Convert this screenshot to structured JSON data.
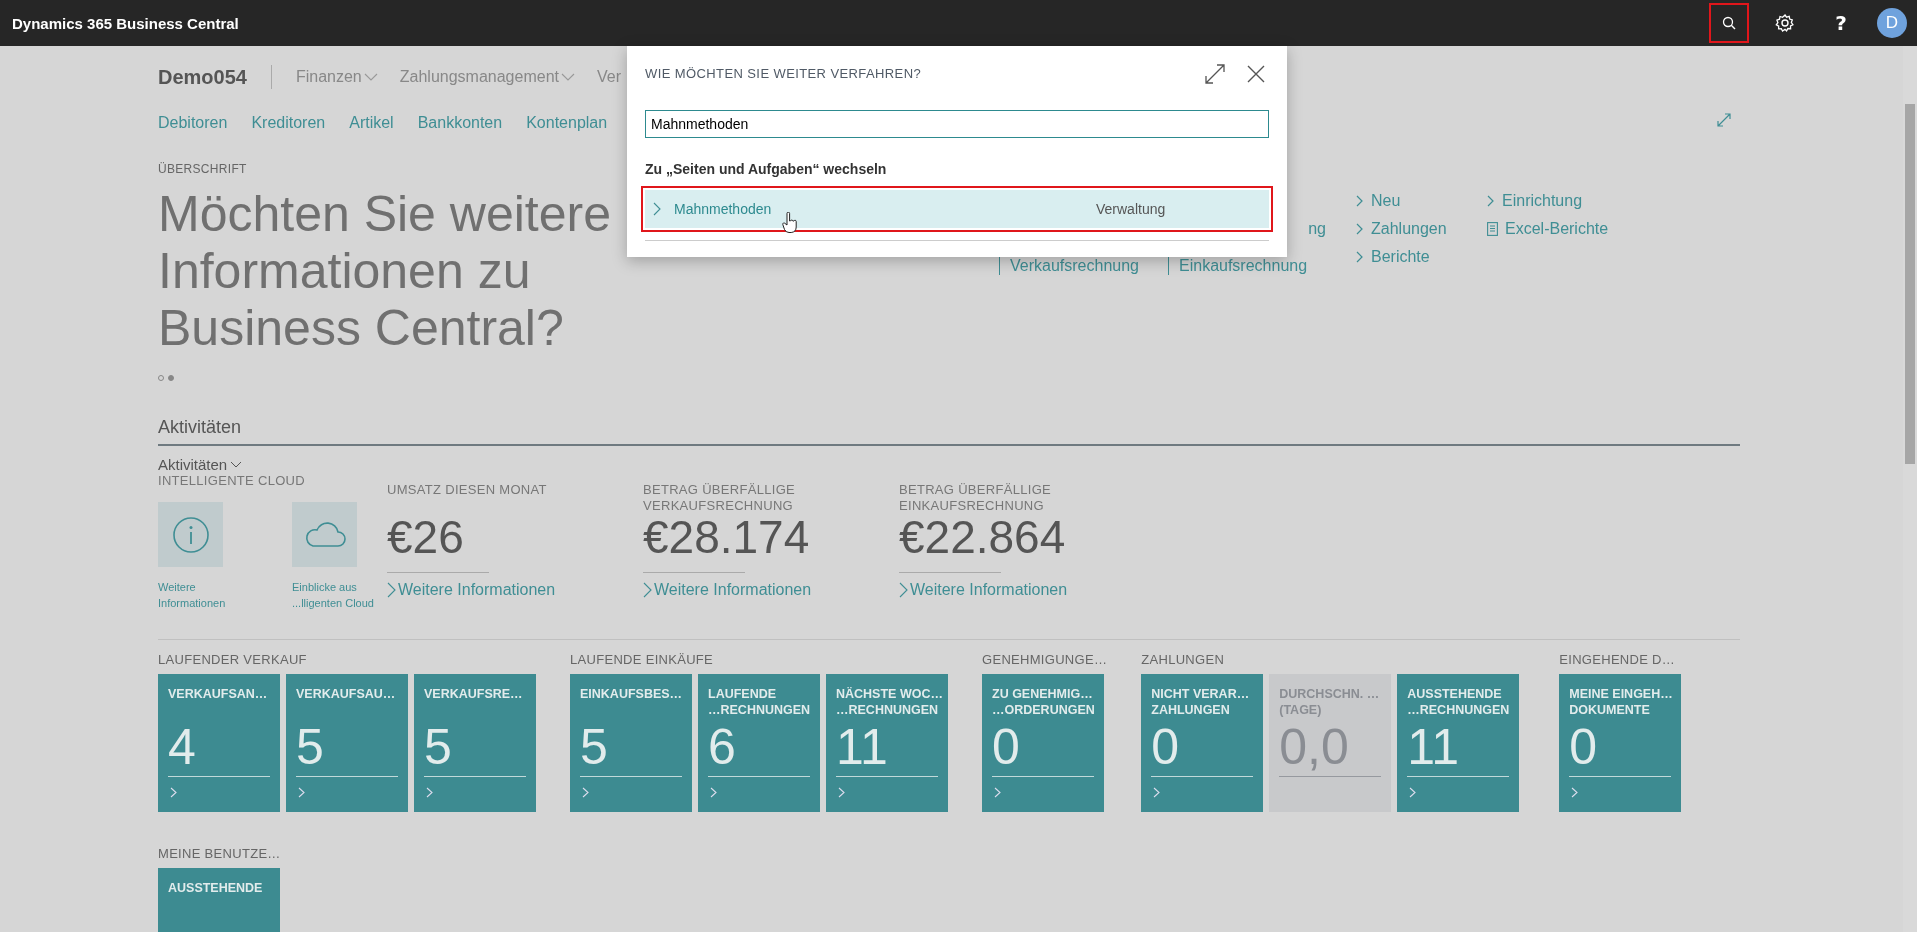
{
  "app_bar": {
    "title": "Dynamics 365 Business Central",
    "avatar": "D",
    "help": "?",
    "search_highlighted": true
  },
  "role_center": {
    "company": "Demo054",
    "menus": [
      {
        "label": "Finanzen",
        "has_menu": true
      },
      {
        "label": "Zahlungsmanagement",
        "has_menu": true
      },
      {
        "label": "Ver",
        "has_menu": false
      }
    ],
    "nav_links": [
      "Debitoren",
      "Kreditoren",
      "Artikel",
      "Bankkonten",
      "Kontenplan"
    ]
  },
  "headline": {
    "caption": "ÜBERSCHRIFT",
    "text": "Möchten Sie weitere Informationen zu Business Central?",
    "dots": [
      {
        "selected": false
      },
      {
        "selected": true
      }
    ]
  },
  "actions": [
    {
      "items": [
        {
          "label": "Verkaufsrechnung",
          "kind": "bar"
        }
      ]
    },
    {
      "items": [
        {
          "label": "ng",
          "kind": "fragment"
        },
        {
          "label": "Einkaufsrechnung",
          "kind": "bar"
        }
      ]
    },
    {
      "items": [
        {
          "label": "Neu",
          "kind": "chevron"
        },
        {
          "label": "Zahlungen",
          "kind": "chevron"
        },
        {
          "label": "Berichte",
          "kind": "chevron"
        }
      ]
    },
    {
      "items": [
        {
          "label": "Einrichtung",
          "kind": "chevron"
        },
        {
          "label": "Excel-Berichte",
          "kind": "report"
        }
      ]
    }
  ],
  "activities": {
    "title": "Aktivitäten",
    "group": "Aktivitäten",
    "cloud": {
      "label": "INTELLIGENTE CLOUD",
      "tiles": [
        {
          "caption": "Weitere Informationen",
          "kind": "info"
        },
        {
          "caption": "Einblicke aus ...lligenten Cloud",
          "kind": "cloud"
        }
      ]
    },
    "kpis": [
      {
        "label": "UMSATZ DIESEN MONAT",
        "value": "€26",
        "link": "Weitere Informationen"
      },
      {
        "label": "BETRAG ÜBERFÄLLIGE VERKAUFSRECHNUNG",
        "value": "€28.174",
        "link": "Weitere Informationen"
      },
      {
        "label": "BETRAG ÜBERFÄLLIGE EINKAUFSRECHNUNG",
        "value": "€22.864",
        "link": "Weitere Informationen"
      }
    ]
  },
  "tile_groups": [
    {
      "title": "LAUFENDER VERKAUF",
      "tiles": [
        {
          "lines": [
            "VERKAUFSAN…"
          ],
          "value": "4",
          "kind": "teal"
        },
        {
          "lines": [
            "VERKAUFSAU…"
          ],
          "value": "5",
          "kind": "teal"
        },
        {
          "lines": [
            "VERKAUFSRE…"
          ],
          "value": "5",
          "kind": "teal"
        }
      ]
    },
    {
      "title": "LAUFENDE EINKÄUFE",
      "tiles": [
        {
          "lines": [
            "EINKAUFSBES…"
          ],
          "value": "5",
          "kind": "teal"
        },
        {
          "lines": [
            "LAUFENDE",
            "…RECHNUNGEN"
          ],
          "value": "6",
          "kind": "teal"
        },
        {
          "lines": [
            "NÄCHSTE WOC…",
            "…RECHNUNGEN"
          ],
          "value": "11",
          "kind": "teal"
        }
      ]
    },
    {
      "title": "GENEHMIGUNGE…",
      "tiles": [
        {
          "lines": [
            "ZU GENEHMIG…",
            "…ORDERUNGEN"
          ],
          "value": "0",
          "kind": "teal"
        }
      ]
    },
    {
      "title": "ZAHLUNGEN",
      "tiles": [
        {
          "lines": [
            "NICHT VERAR…",
            "ZAHLUNGEN"
          ],
          "value": "0",
          "kind": "teal"
        },
        {
          "lines": [
            "DURCHSCHN. …",
            "(TAGE)"
          ],
          "value": "0,0",
          "kind": "neutral"
        },
        {
          "lines": [
            "AUSSTEHENDE",
            "…RECHNUNGEN"
          ],
          "value": "11",
          "kind": "teal"
        }
      ]
    },
    {
      "title": "EINGEHENDE D…",
      "tiles": [
        {
          "lines": [
            "MEINE EINGEH…",
            "DOKUMENTE"
          ],
          "value": "0",
          "kind": "teal"
        }
      ]
    },
    {
      "title": "MEINE BENUTZE…",
      "tiles": [
        {
          "lines": [
            "AUSSTEHENDE"
          ],
          "kind": "teal"
        }
      ]
    }
  ],
  "dialog": {
    "title": "WIE MÖCHTEN SIE WEITER VERFAHREN?",
    "search_value": "Mahnmethoden",
    "section": "Zu „Seiten und Aufgaben“ wechseln",
    "results": [
      {
        "name": "Mahnmethoden",
        "category": "Verwaltung",
        "selected": true
      }
    ]
  }
}
